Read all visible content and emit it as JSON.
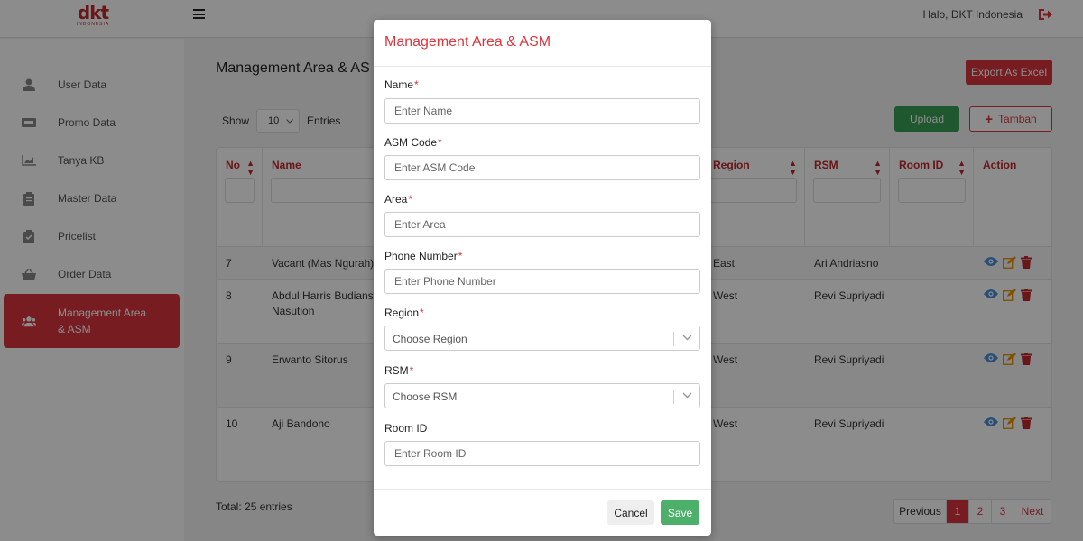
{
  "header": {
    "logo_text": "dkt",
    "logo_sub": "INDONESIA",
    "greeting": "Halo, DKT Indonesia"
  },
  "sidebar": {
    "items": [
      {
        "label": "User Data",
        "icon": "user-icon"
      },
      {
        "label": "Promo Data",
        "icon": "ticket-icon"
      },
      {
        "label": "Tanya KB",
        "icon": "chart-icon"
      },
      {
        "label": "Master Data",
        "icon": "clipboard-icon"
      },
      {
        "label": "Pricelist",
        "icon": "clipboard-check-icon"
      },
      {
        "label": "Order Data",
        "icon": "basket-icon"
      },
      {
        "label_line1": "Management Area",
        "label_line2": "& ASM",
        "icon": "users-icon",
        "active": true
      }
    ]
  },
  "main": {
    "title": "Management Area & AS",
    "export_label": "Export As Excel",
    "upload_label": "Upload",
    "tambah_label": "Tambah",
    "show_label": "Show",
    "entries_value": "10",
    "entries_label": "Entries",
    "columns": {
      "no": "No",
      "name": "Name",
      "region": "Region",
      "rsm": "RSM",
      "room_id": "Room ID",
      "action": "Action"
    },
    "rows": [
      {
        "no": "7",
        "name_line1": "Vacant (Mas Ngurah)",
        "name_line2": "",
        "region": "East",
        "rsm": "Ari Andriasno"
      },
      {
        "no": "8",
        "name_line1": "Abdul Harris Budiansya",
        "name_line2": "Nasution",
        "region": "West",
        "rsm": "Revi Supriyadi"
      },
      {
        "no": "9",
        "name_line1": "Erwanto Sitorus",
        "name_line2": "",
        "region": "West",
        "rsm": "Revi Supriyadi"
      },
      {
        "no": "10",
        "name_line1": "Aji Bandono",
        "name_line2": "",
        "region": "West",
        "rsm": "Revi Supriyadi"
      }
    ],
    "total": "Total: 25 entries",
    "pagination": {
      "previous": "Previous",
      "pages": [
        "1",
        "2",
        "3"
      ],
      "current": "1",
      "next": "Next"
    }
  },
  "modal": {
    "title": "Management Area & ASM",
    "fields": {
      "name": {
        "label": "Name",
        "placeholder": "Enter Name"
      },
      "asm_code": {
        "label": "ASM Code",
        "placeholder": "Enter ASM Code"
      },
      "area": {
        "label": "Area",
        "placeholder": "Enter Area"
      },
      "phone": {
        "label": "Phone Number",
        "placeholder": "Enter Phone Number"
      },
      "region": {
        "label": "Region",
        "placeholder": "Choose Region"
      },
      "rsm": {
        "label": "RSM",
        "placeholder": "Choose RSM"
      },
      "room_id": {
        "label": "Room ID",
        "placeholder": "Enter Room ID"
      }
    },
    "required_mark": "*",
    "cancel_label": "Cancel",
    "save_label": "Save"
  },
  "colors": {
    "accent": "#d9363e",
    "success": "#3aa055",
    "icon_blue": "#4a90d9",
    "icon_orange": "#e59400"
  }
}
